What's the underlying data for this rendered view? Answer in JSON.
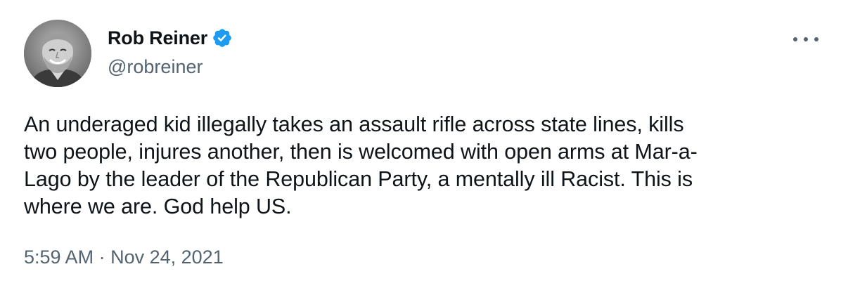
{
  "author": {
    "display_name": "Rob Reiner",
    "handle": "@robreiner",
    "verified": true,
    "avatar_icon": "profile-photo"
  },
  "tweet": {
    "lines": [
      "An underaged kid illegally takes an assault rifle across state lines, kills",
      "two people, injures another, then is welcomed with open arms at Mar-a-",
      "Lago by the leader of the Republican Party, a mentally ill Racist. This is",
      "where we are. God help US."
    ]
  },
  "meta": {
    "time": "5:59 AM",
    "separator": "·",
    "date": "Nov 24, 2021"
  },
  "menu": {
    "icon": "more-icon"
  },
  "colors": {
    "text_primary": "#0f1419",
    "text_secondary": "#536471",
    "verified_badge": "#1d9bf0"
  }
}
